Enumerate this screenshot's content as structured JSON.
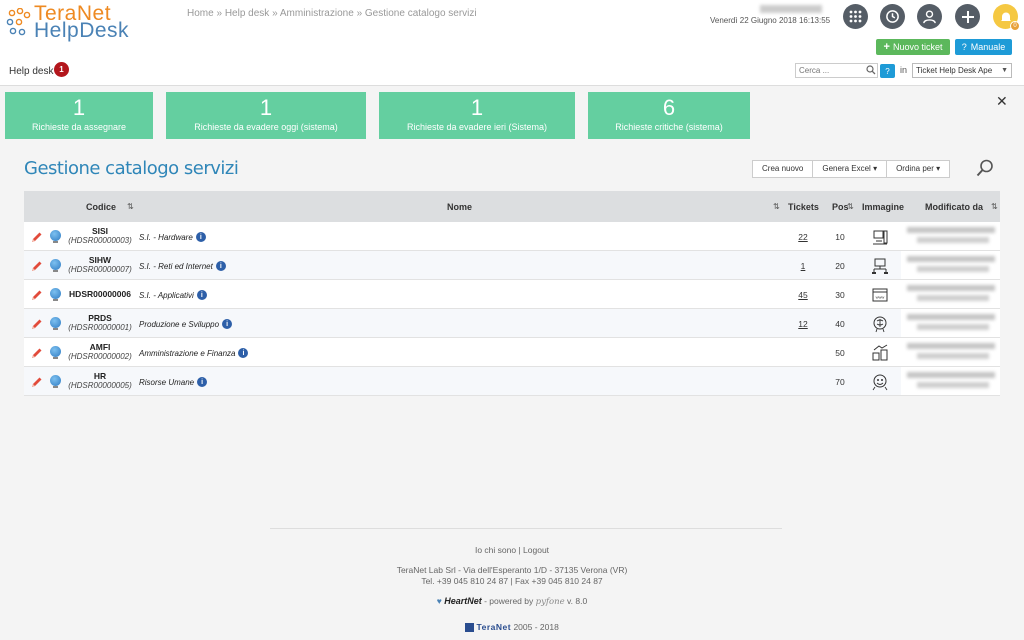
{
  "logo": {
    "line1": "TeraNet",
    "line2": "HelpDesk"
  },
  "breadcrumb": [
    "Home",
    "Help desk",
    "Amministrazione",
    "Gestione catalogo servizi"
  ],
  "breadcrumb_sep": "»",
  "datetime": "Venerdì 22 Giugno 2018 16:13:55",
  "toolbar": {
    "icons": [
      "apps-grid-icon",
      "history-icon",
      "user-icon",
      "plus-icon",
      "bell-icon"
    ],
    "bell_count": "0",
    "new_ticket_label": "Nuovo ticket",
    "manual_label": "Manuale"
  },
  "helpdesk_tab": {
    "label": "Help desk",
    "count": "1"
  },
  "search": {
    "placeholder": "Cerca ...",
    "help": "?",
    "in_label": "in",
    "scope": "Ticket Help Desk Ape"
  },
  "tiles": [
    {
      "num": "1",
      "label": "Richieste da assegnare"
    },
    {
      "num": "1",
      "label": "Richieste da evadere oggi (sistema)"
    },
    {
      "num": "1",
      "label": "Richieste da evadere ieri (Sistema)"
    },
    {
      "num": "6",
      "label": "Richieste critiche (sistema)"
    }
  ],
  "page_title": "Gestione catalogo servizi",
  "actions": {
    "create": "Crea nuovo",
    "excel": "Genera Excel",
    "order": "Ordina per"
  },
  "table": {
    "headers": {
      "code": "Codice",
      "name": "Nome",
      "tickets": "Tickets",
      "pos": "Pos",
      "image": "Immagine",
      "modified": "Modificato da"
    },
    "rows": [
      {
        "code": "SISI",
        "sub": "(HDSR00000003)",
        "name": "S.I. - Hardware",
        "tickets": "22",
        "pos": "10",
        "icon": "hardware-icon"
      },
      {
        "code": "SIHW",
        "sub": "(HDSR00000007)",
        "name": "S.I. - Reti ed Internet",
        "tickets": "1",
        "pos": "20",
        "icon": "network-icon"
      },
      {
        "code": "HDSR00000006",
        "sub": "",
        "name": "S.I. - Applicativi",
        "tickets": "45",
        "pos": "30",
        "icon": "www-icon"
      },
      {
        "code": "PRDS",
        "sub": "(HDSR00000001)",
        "name": "Produzione e Sviluppo",
        "tickets": "12",
        "pos": "40",
        "icon": "brain-icon"
      },
      {
        "code": "AMFI",
        "sub": "(HDSR00000002)",
        "name": "Amministrazione e Finanza",
        "tickets": "",
        "pos": "50",
        "icon": "finance-icon"
      },
      {
        "code": "HR",
        "sub": "(HDSR00000005)",
        "name": "Risorse Umane",
        "tickets": "",
        "pos": "70",
        "icon": "hr-icon"
      }
    ]
  },
  "footer": {
    "whoami": "Io chi sono",
    "sep": "|",
    "logout": "Logout",
    "address": "TeraNet Lab Srl - Via dell'Esperanto 1/D - 37135 Verona (VR)",
    "phone": "Tel. +39 045 810 24 87 | Fax +39 045 810 24 87",
    "brand": "HeartNet",
    "powered": "- powered by",
    "pfone": "pyfone",
    "version": "v. 8.0",
    "company": "TeraNet",
    "years": "2005 - 2018"
  },
  "colors": {
    "tile": "#64cfa0",
    "title": "#2f86b8",
    "green": "#5cb85c",
    "blue": "#1e9bd7",
    "badge": "#b3161c"
  }
}
